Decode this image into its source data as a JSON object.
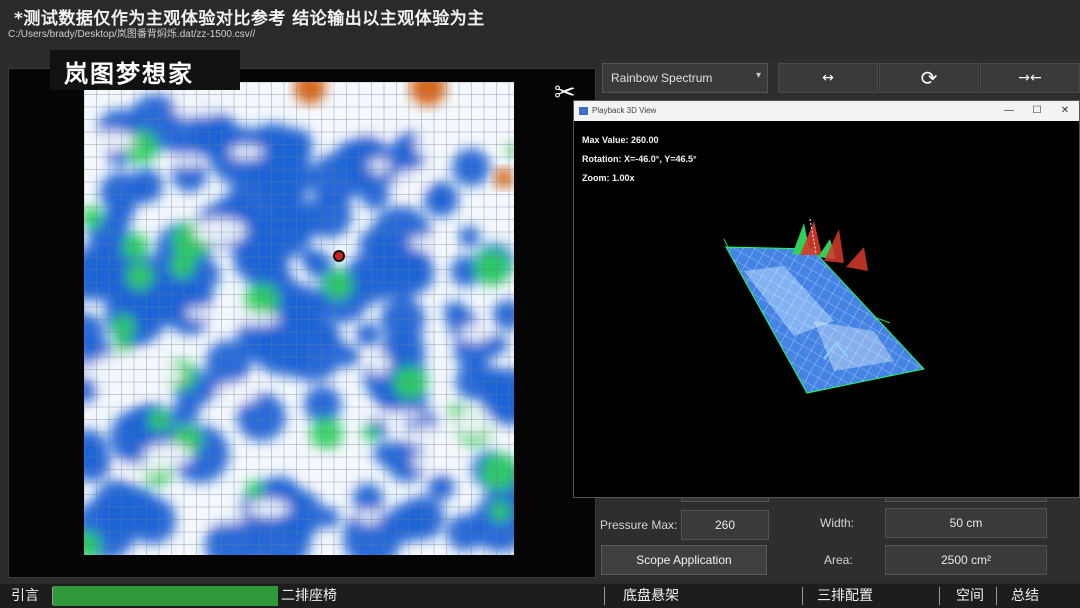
{
  "banner": {
    "disclaimer": "*测试数据仅作为主观体验对比参考 结论输出以主观体验为主",
    "file_path": "C:/Users/brady/Desktop/岚图番背焖烁.dat/zz-1500.csv//"
  },
  "watermark": "岚图梦想家",
  "colors": {
    "low": "#1f63d6",
    "mid": "#2fd15c",
    "high": "#d8681e",
    "progress": "#2f9a3a"
  },
  "toolbar": {
    "spectrum": "Rainbow Spectrum",
    "expand_icon": "expand-horizontal-icon",
    "rotate_icon": "rotate-icon",
    "compress_icon": "compress-horizontal-icon"
  },
  "playback_window": {
    "title": "Playback 3D View",
    "max_value": "Max Value: 260.00",
    "rotation": "Rotation: X=-46.0°, Y=46.5°",
    "zoom": "Zoom: 1.00x"
  },
  "fields": {
    "pressure_max_label": "Pressure Max:",
    "pressure_max_value": "260",
    "width_label": "Width:",
    "width_value": "50 cm",
    "area_label": "Area:",
    "area_value": "2500 cm²",
    "scope_button": "Scope Application"
  },
  "segments": [
    "引言",
    "二排座椅",
    "底盘悬架",
    "三排配置",
    "空间",
    "总结"
  ],
  "progress_fraction": 0.27
}
